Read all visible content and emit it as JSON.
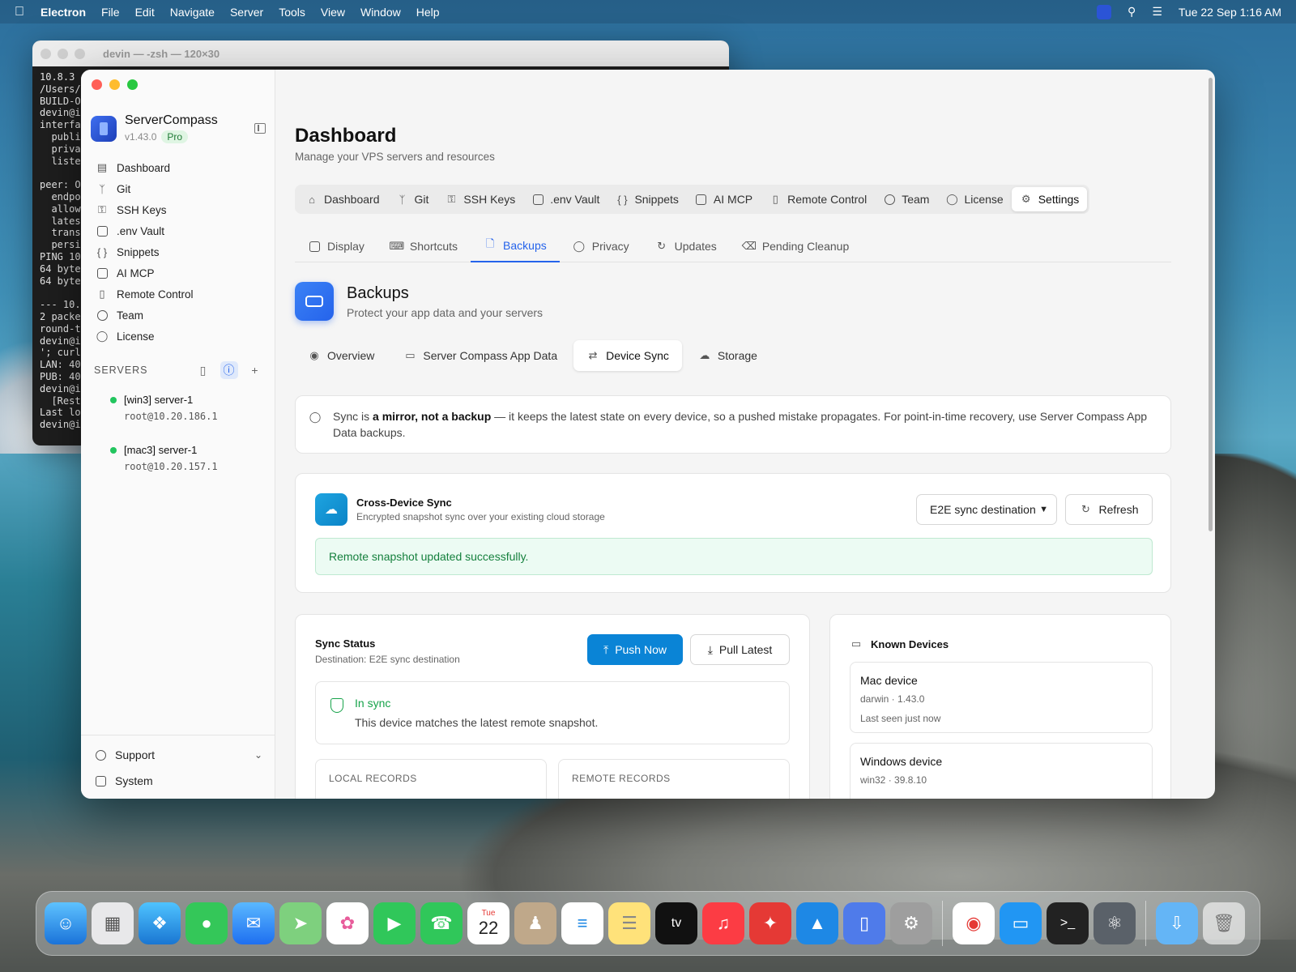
{
  "menubar": {
    "app": "Electron",
    "items": [
      "File",
      "Edit",
      "Navigate",
      "Server",
      "Tools",
      "View",
      "Window",
      "Help"
    ],
    "datetime": "Tue 22 Sep  1:16 AM"
  },
  "terminal": {
    "title": "devin — -zsh — 120×30",
    "lines": [
      "10.8.3",
      "/Users/",
      "BUILD-O",
      "devin@i",
      "interfa",
      "  publi",
      "  priva",
      "  liste",
      "",
      "peer: O",
      "  endpo",
      "  allow",
      "  lates",
      "  trans",
      "  persi",
      "PING 10",
      "64 byte",
      "64 byte",
      "",
      "--- 10.",
      "2 packe",
      "round-t",
      "devin@i",
      "'; curl",
      "LAN: 40",
      "PUB: 40",
      "devin@i",
      "  [Rest",
      "Last lo",
      "devin@i"
    ]
  },
  "sidebar": {
    "brand_name": "ServerCompass",
    "version": "v1.43.0",
    "badge": "Pro",
    "nav": [
      {
        "label": "Dashboard",
        "icon": "server-icon"
      },
      {
        "label": "Git",
        "icon": "git-branch-icon"
      },
      {
        "label": "SSH Keys",
        "icon": "key-icon"
      },
      {
        "label": ".env Vault",
        "icon": "lock-icon"
      },
      {
        "label": "Snippets",
        "icon": "braces-icon"
      },
      {
        "label": "AI MCP",
        "icon": "bot-icon"
      },
      {
        "label": "Remote Control",
        "icon": "phone-icon"
      },
      {
        "label": "Team",
        "icon": "users-icon"
      },
      {
        "label": "License",
        "icon": "shield-icon"
      }
    ],
    "servers_heading": "SERVERS",
    "servers": [
      {
        "name": "[win3] server-1",
        "host": "root@10.20.186.1"
      },
      {
        "name": "[mac3] server-1",
        "host": "root@10.20.157.1"
      }
    ],
    "support": "Support",
    "system": "System"
  },
  "main": {
    "title": "Dashboard",
    "subtitle": "Manage your VPS servers and resources",
    "top_tabs": [
      {
        "label": "Dashboard",
        "icon": "home-icon"
      },
      {
        "label": "Git",
        "icon": "git-branch-icon"
      },
      {
        "label": "SSH Keys",
        "icon": "key-icon"
      },
      {
        "label": ".env Vault",
        "icon": "lock-icon"
      },
      {
        "label": "Snippets",
        "icon": "braces-icon"
      },
      {
        "label": "AI MCP",
        "icon": "bot-icon"
      },
      {
        "label": "Remote Control",
        "icon": "phone-icon"
      },
      {
        "label": "Team",
        "icon": "users-icon"
      },
      {
        "label": "License",
        "icon": "shield-check-icon"
      },
      {
        "label": "Settings",
        "icon": "gear-icon"
      }
    ],
    "sub_tabs": [
      {
        "label": "Display",
        "icon": "monitor-icon"
      },
      {
        "label": "Shortcuts",
        "icon": "keyboard-icon"
      },
      {
        "label": "Backups",
        "icon": "file-icon"
      },
      {
        "label": "Privacy",
        "icon": "shield-icon"
      },
      {
        "label": "Updates",
        "icon": "refresh-icon"
      },
      {
        "label": "Pending Cleanup",
        "icon": "eraser-icon"
      }
    ],
    "section_title": "Backups",
    "section_subtitle": "Protect your app data and your servers",
    "seg_tabs": [
      {
        "label": "Overview",
        "icon": "eye-icon"
      },
      {
        "label": "Server Compass App Data",
        "icon": "laptop-icon"
      },
      {
        "label": "Device Sync",
        "icon": "arrows-icon"
      },
      {
        "label": "Storage",
        "icon": "cloud-icon"
      }
    ],
    "notice": {
      "pre": "Sync is ",
      "bold": "a mirror, not a backup",
      "post": " — it keeps the latest state on every device, so a pushed mistake propagates. For point-in-time recovery, use Server Compass App Data backups."
    },
    "cross_sync": {
      "title": "Cross-Device Sync",
      "subtitle": "Encrypted snapshot sync over your existing cloud storage",
      "destination_value": "E2E sync destination",
      "refresh_label": "Refresh",
      "success_message": "Remote snapshot updated successfully."
    },
    "sync_status": {
      "title": "Sync Status",
      "destination": "Destination: E2E sync destination",
      "push_label": "Push Now",
      "pull_label": "Pull Latest",
      "state_title": "In sync",
      "state_desc": "This device matches the latest remote snapshot.",
      "local_label": "LOCAL RECORDS",
      "remote_label": "REMOTE RECORDS"
    },
    "known_devices": {
      "title": "Known Devices",
      "devices": [
        {
          "name": "Mac device",
          "meta": "darwin · 1.43.0",
          "seen": "Last seen just now"
        },
        {
          "name": "Windows device",
          "meta": "win32 · 39.8.10",
          "seen": ""
        }
      ]
    }
  },
  "dock": {
    "apps": [
      "finder-icon",
      "launchpad-icon",
      "safari-icon",
      "messages-icon",
      "mail-icon",
      "maps-icon",
      "photos-icon",
      "facetime-icon",
      "phone-icon",
      "calendar-icon",
      "contacts-icon",
      "reminders-icon",
      "notes-icon",
      "tv-icon",
      "music-icon",
      "rocket-icon",
      "app-store-icon",
      "servercompass-icon",
      "settings-icon",
      "chrome-icon",
      "files-icon",
      "terminal-icon",
      "electron-icon",
      "downloads-icon",
      "trash-icon"
    ],
    "calendar_month": "Tue",
    "calendar_day": "22",
    "tv_label": "tv"
  }
}
